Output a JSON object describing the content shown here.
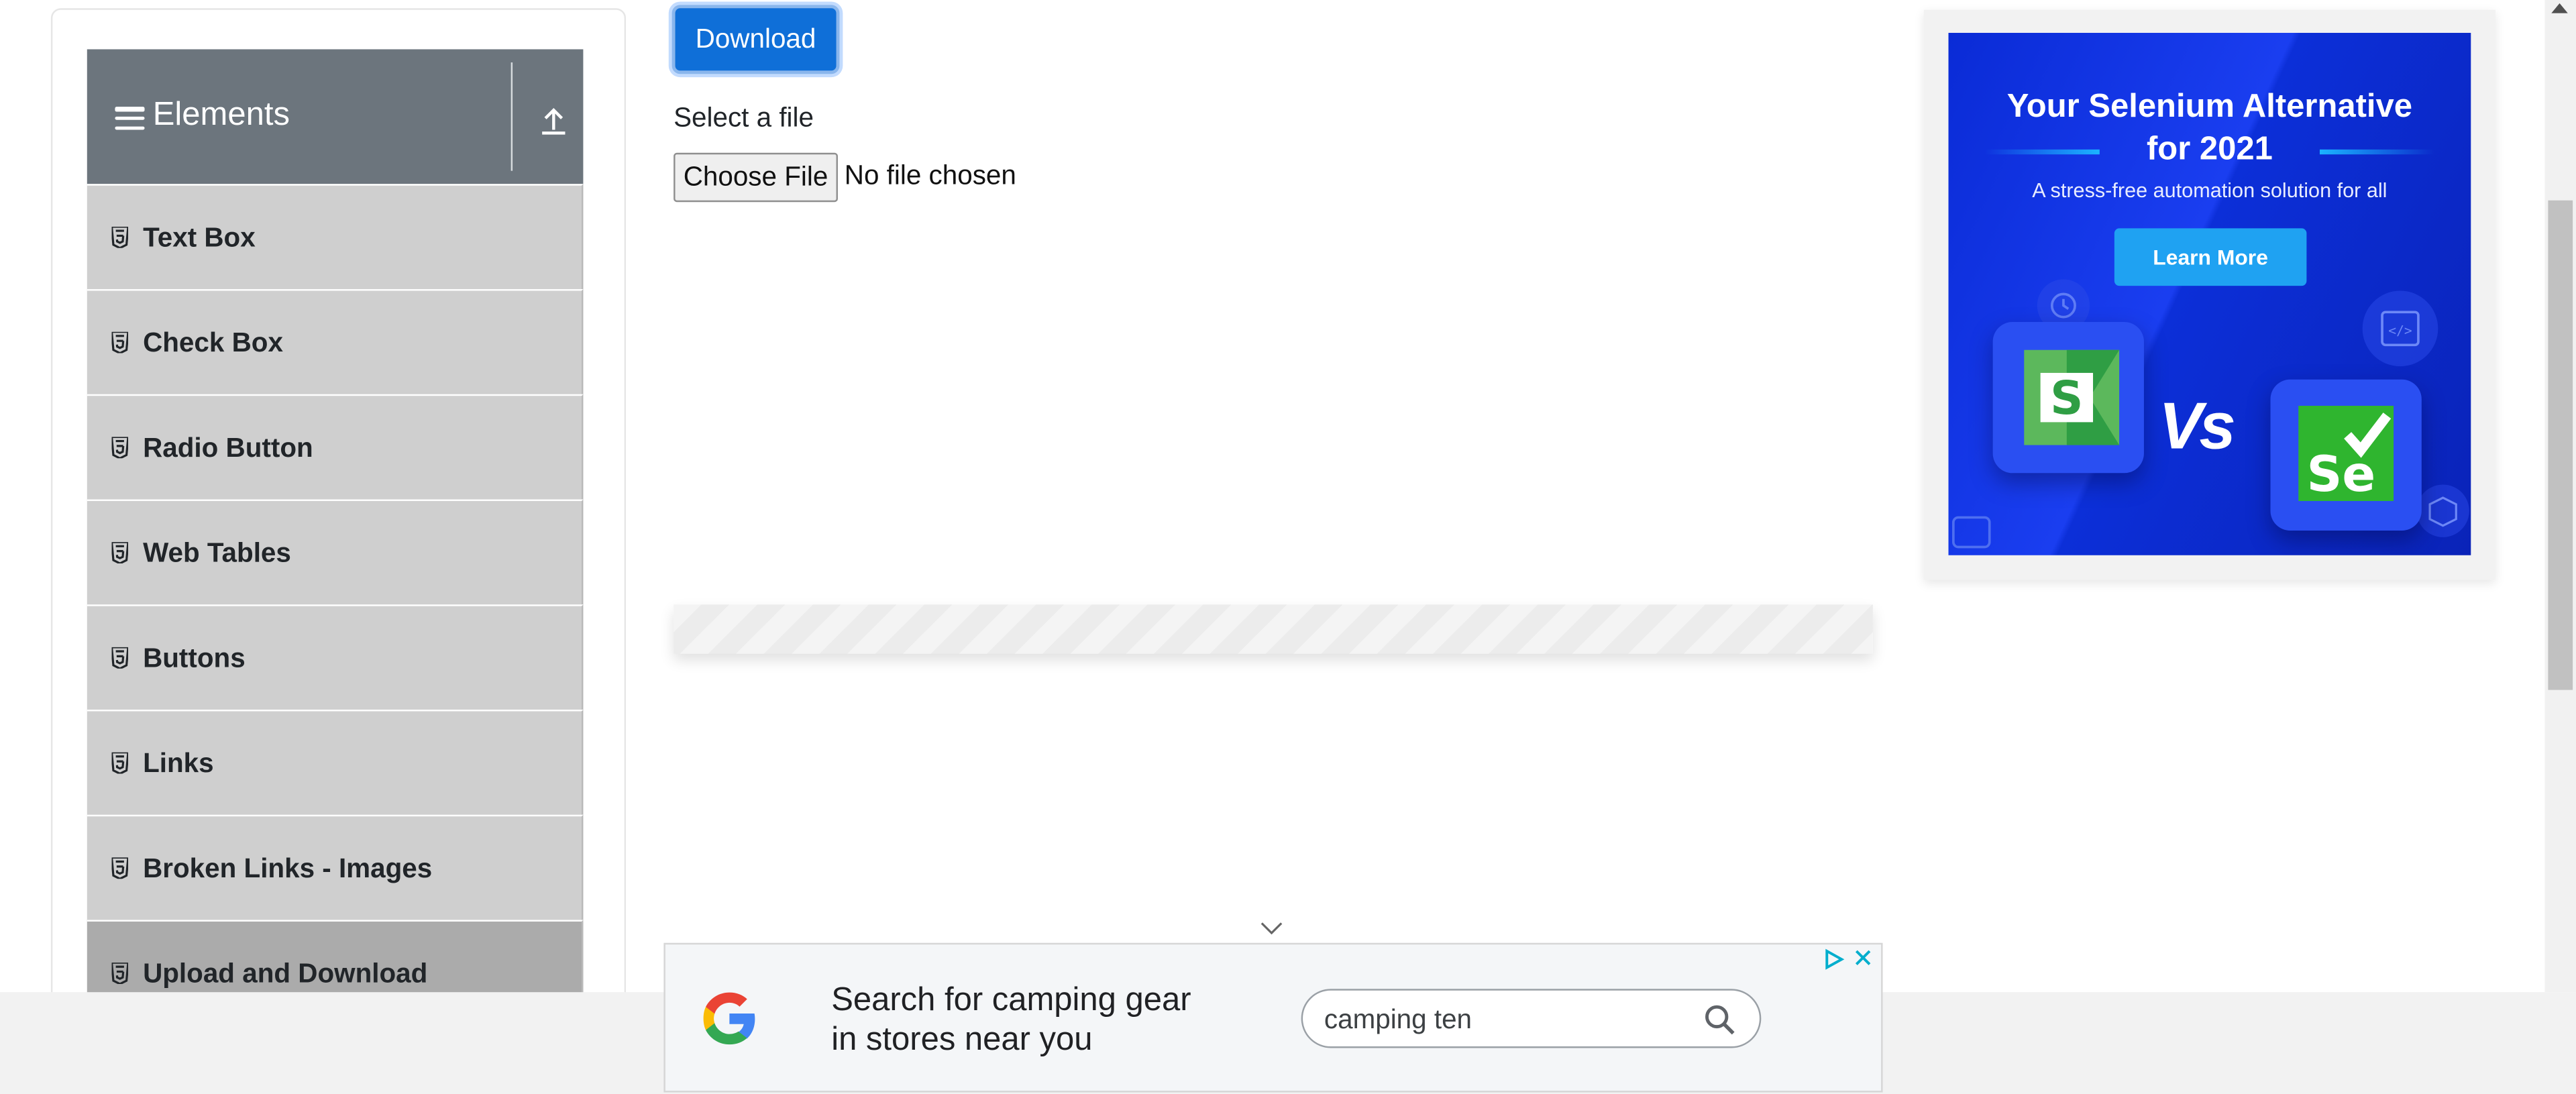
{
  "sidebar": {
    "group_title": "Elements",
    "items": [
      {
        "label": "Text Box",
        "active": false
      },
      {
        "label": "Check Box",
        "active": false
      },
      {
        "label": "Radio Button",
        "active": false
      },
      {
        "label": "Web Tables",
        "active": false
      },
      {
        "label": "Buttons",
        "active": false
      },
      {
        "label": "Links",
        "active": false
      },
      {
        "label": "Broken Links - Images",
        "active": false
      },
      {
        "label": "Upload and Download",
        "active": true
      }
    ],
    "header_color": "#6c757d",
    "item_color": "#cfcfcf",
    "active_item_color": "#ababab"
  },
  "main": {
    "download_label": "Download",
    "select_label": "Select a file",
    "file_button_label": "Choose File",
    "file_status": "No file chosen",
    "accent_color": "#0f6fd8"
  },
  "side_ad": {
    "headline_line1": "Your Selenium Alternative",
    "headline_line2": "for 2021",
    "subtitle": "A stress-free automation solution for all",
    "cta_label": "Learn More",
    "vs_text": "Vs",
    "left_logo_letter": "S",
    "right_logo_text": "Se",
    "background_color": "#0a2bd6"
  },
  "bottom_ad": {
    "line1": "Search for camping gear",
    "line2": "in stores near you",
    "search_value": "camping ten",
    "icons": [
      "google-g-icon",
      "search-icon",
      "adchoices-icon",
      "close-icon"
    ]
  }
}
